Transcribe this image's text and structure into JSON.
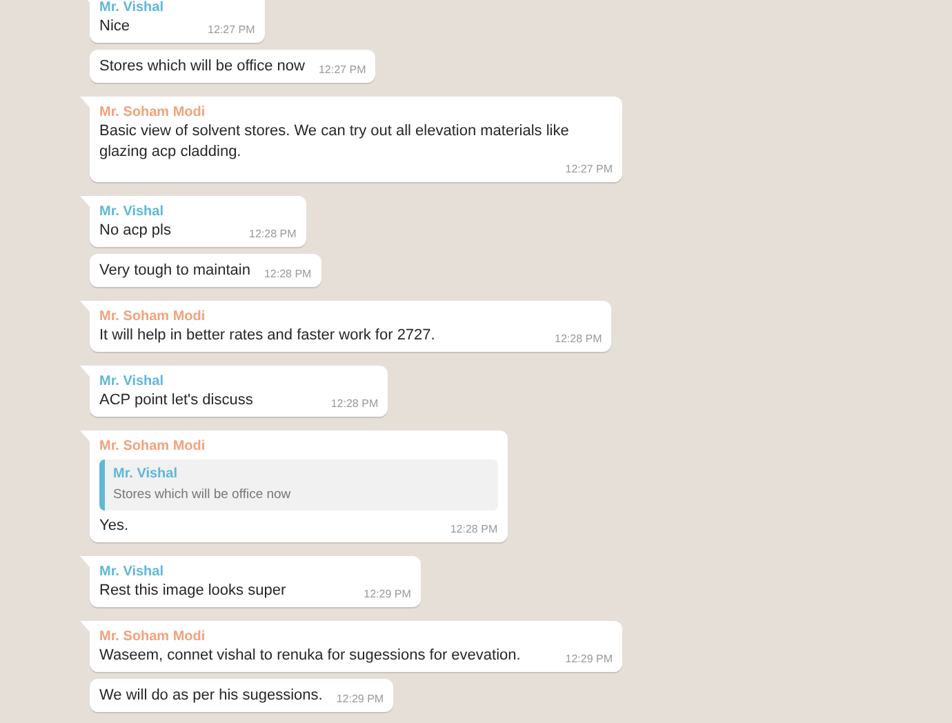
{
  "messages": [
    {
      "sender": "Mr. Vishal",
      "color": "#5fb8da",
      "text": "Nice",
      "time": "12:27 PM"
    },
    {
      "text": "Stores which will be office now",
      "time": "12:27 PM"
    },
    {
      "sender": "Mr. Soham Modi",
      "color": "#f2a27c",
      "text": "Basic view of solvent stores. We can try out all elevation materials like glazing acp cladding.",
      "time": "12:27 PM"
    },
    {
      "sender": "Mr. Vishal",
      "color": "#5fb8da",
      "text": "No acp pls",
      "time": "12:28 PM"
    },
    {
      "text": "Very tough to maintain",
      "time": "12:28 PM"
    },
    {
      "sender": "Mr. Soham Modi",
      "color": "#f2a27c",
      "text": "It will help in better rates and faster work for 2727.",
      "time": "12:28 PM"
    },
    {
      "sender": "Mr. Vishal",
      "color": "#5fb8da",
      "text": "ACP point let's discuss",
      "time": "12:28 PM"
    },
    {
      "sender": "Mr. Soham Modi",
      "color": "#f2a27c",
      "quote": {
        "sender": "Mr. Vishal",
        "color": "#5fb8da",
        "text": "Stores which will be office now"
      },
      "text": "Yes.",
      "time": "12:28 PM"
    },
    {
      "sender": "Mr. Vishal",
      "color": "#5fb8da",
      "text": "Rest this image looks super",
      "time": "12:29 PM"
    },
    {
      "sender": "Mr. Soham Modi",
      "color": "#f2a27c",
      "text": "Waseem, connet vishal to renuka for sugessions for evevation.",
      "time": "12:29 PM"
    },
    {
      "text": "We will do as per his sugessions.",
      "time": "12:29 PM"
    }
  ]
}
